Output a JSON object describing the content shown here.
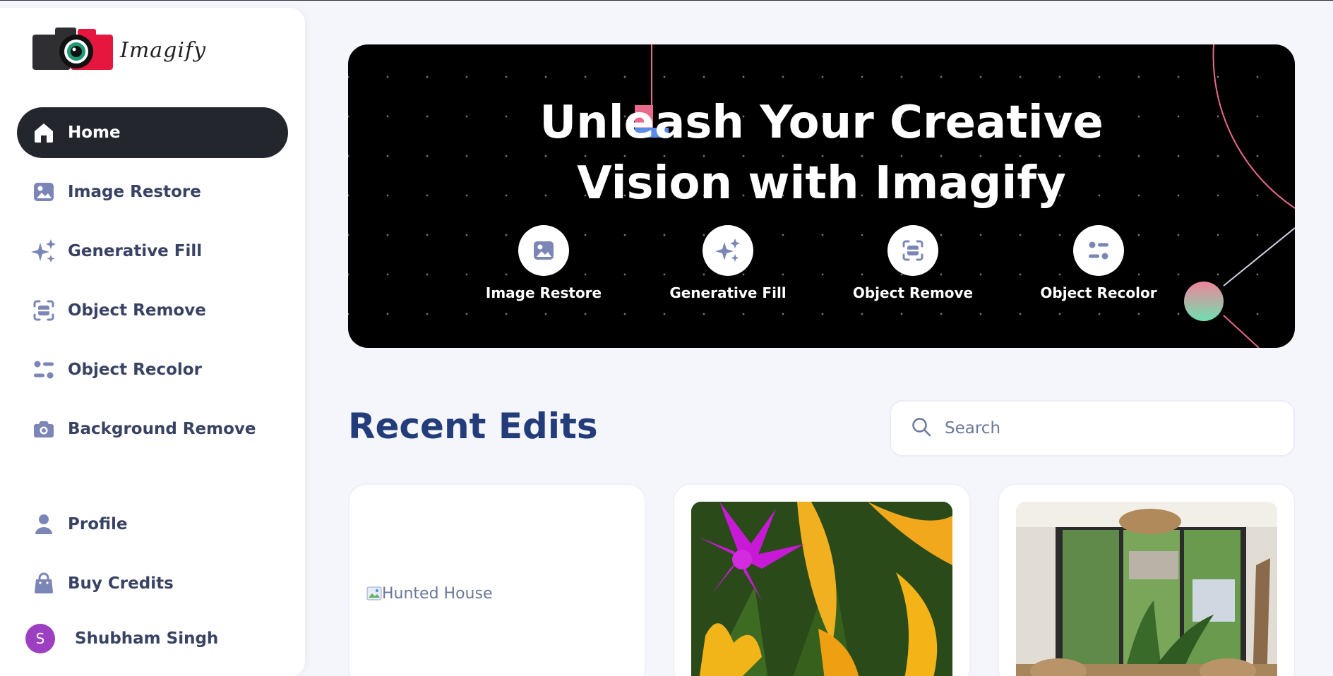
{
  "brand": {
    "name": "Imagify"
  },
  "sidebar": {
    "items": [
      {
        "label": "Home",
        "icon": "home-icon",
        "active": true
      },
      {
        "label": "Image Restore",
        "icon": "image-icon"
      },
      {
        "label": "Generative Fill",
        "icon": "sparkles-icon"
      },
      {
        "label": "Object Remove",
        "icon": "scan-icon"
      },
      {
        "label": "Object Recolor",
        "icon": "filters-icon"
      },
      {
        "label": "Background Remove",
        "icon": "camera-icon"
      }
    ],
    "bottom": [
      {
        "label": "Profile",
        "icon": "user-icon"
      },
      {
        "label": "Buy Credits",
        "icon": "bag-icon"
      }
    ],
    "user": {
      "initial": "S",
      "name": "Shubham Singh"
    }
  },
  "hero": {
    "title_line1": "Unleash Your Creative",
    "title_line2": "Vision with Imagify",
    "tools": [
      {
        "label": "Image Restore",
        "icon": "image-icon"
      },
      {
        "label": "Generative Fill",
        "icon": "sparkles-icon"
      },
      {
        "label": "Object Remove",
        "icon": "scan-icon"
      },
      {
        "label": "Object Recolor",
        "icon": "filters-icon"
      }
    ]
  },
  "recent": {
    "title": "Recent Edits",
    "search_placeholder": "Search",
    "cards": [
      {
        "alt": "Hunted House",
        "image": "broken-image"
      },
      {
        "alt": "",
        "image": "flowers-photo"
      },
      {
        "alt": "",
        "image": "interior-photo"
      }
    ]
  },
  "colors": {
    "accent_dark": "#24262d",
    "title_blue": "#233c7a",
    "icon_slate": "#7c86b6",
    "avatar": "#9c3fc0"
  }
}
